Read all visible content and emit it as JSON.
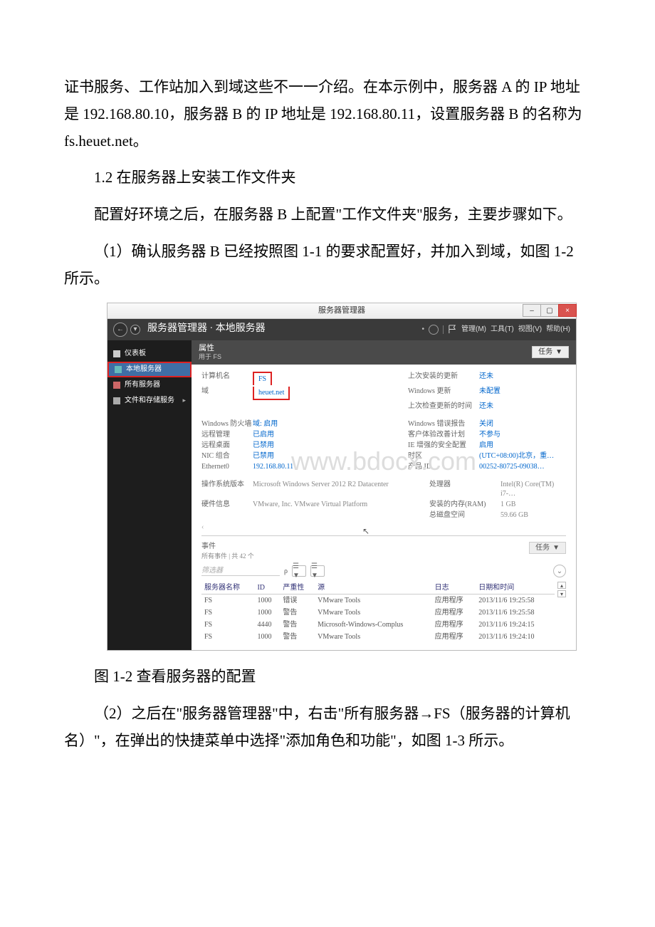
{
  "paragraphs": {
    "p1": "证书服务、工作站加入到域这些不一一介绍。在本示例中，服务器 A 的 IP 地址是 192.168.80.10，服务器 B 的 IP 地址是 192.168.80.11，设置服务器 B 的名称为 fs.heuet.net。",
    "p2": "1.2 在服务器上安装工作文件夹",
    "p3": "配置好环境之后，在服务器 B 上配置\"工作文件夹\"服务，主要步骤如下。",
    "p4": "（1）确认服务器 B 已经按照图 1-1 的要求配置好，并加入到域，如图 1-2 所示。",
    "caption": "图 1-2 查看服务器的配置",
    "p5": "（2）之后在\"服务器管理器\"中，右击\"所有服务器→FS（服务器的计算机名）\"，在弹出的快捷菜单中选择\"添加角色和功能\"，如图 1-3 所示。"
  },
  "window": {
    "title": "服务器管理器",
    "nav_back_aria": "返回",
    "nav_fwd_aria": "前进",
    "breadcrumb": "服务器管理器 · 本地服务器",
    "menu": {
      "refresh": "刷新",
      "manage": "管理(M)",
      "tools": "工具(T)",
      "view": "视图(V)",
      "help": "帮助(H)"
    }
  },
  "sidebar": {
    "dashboard": "仪表板",
    "local": "本地服务器",
    "all": "所有服务器",
    "file": "文件和存储服务"
  },
  "panel": {
    "props_label": "属性",
    "props_sub": "用于 FS",
    "task_label": "任务",
    "task_caret": "▼"
  },
  "properties": {
    "left": {
      "computer_name_lbl": "计算机名",
      "computer_name_val": "FS",
      "domain_lbl": "域",
      "domain_val": "heuet.net",
      "firewall_lbl": "Windows 防火墙",
      "firewall_val": "域: 启用",
      "remote_mgmt_lbl": "远程管理",
      "remote_mgmt_val": "已启用",
      "remote_desktop_lbl": "远程桌面",
      "remote_desktop_val": "已禁用",
      "nic_team_lbl": "NIC 组合",
      "nic_team_val": "已禁用",
      "ethernet_lbl": "Ethernet0",
      "ethernet_val": "192.168.80.11",
      "os_ver_lbl": "操作系统版本",
      "os_ver_val": "Microsoft Windows Server 2012 R2 Datacenter",
      "hw_lbl": "硬件信息",
      "hw_val": "VMware, Inc. VMware Virtual Platform"
    },
    "right": {
      "last_update_lbl": "上次安装的更新",
      "last_update_val": "还未",
      "win_update_lbl": "Windows 更新",
      "win_update_val": "未配置",
      "last_check_lbl": "上次检查更新的时间",
      "last_check_val": "还未",
      "err_report_lbl": "Windows 错误报告",
      "err_report_val": "关闭",
      "ceip_lbl": "客户体验改善计划",
      "ceip_val": "不参与",
      "iesc_lbl": "IE 增强的安全配置",
      "iesc_val": "启用",
      "tz_lbl": "时区",
      "tz_val": "(UTC+08:00)北京，重…",
      "pid_lbl": "产品 ID",
      "pid_val": "00252-80725-09038…",
      "cpu_lbl": "处理器",
      "cpu_val": "Intel(R) Core(TM) i7-…",
      "ram_lbl": "安装的内存(RAM)",
      "ram_val": "1 GB",
      "disk_lbl": "总磁盘空间",
      "disk_val": "59.66 GB"
    }
  },
  "events_panel": {
    "head": "事件",
    "sub": "所有事件 | 共 42 个",
    "filter_placeholder": "筛选器",
    "search_icon": "ρ",
    "filter_btn1": "☰ ▼",
    "filter_btn2": "☰ ▼",
    "expand": "⌄",
    "task_label": "任务",
    "task_caret": "▼",
    "cols": {
      "server": "服务器名称",
      "id": "ID",
      "sev": "严重性",
      "src": "源",
      "log": "日志",
      "dt": "日期和时间"
    },
    "rows": [
      {
        "server": "FS",
        "id": "1000",
        "sev": "错误",
        "src": "VMware Tools",
        "log": "应用程序",
        "dt": "2013/11/6 19:25:58"
      },
      {
        "server": "FS",
        "id": "1000",
        "sev": "警告",
        "src": "VMware Tools",
        "log": "应用程序",
        "dt": "2013/11/6 19:25:58"
      },
      {
        "server": "FS",
        "id": "4440",
        "sev": "警告",
        "src": "Microsoft-Windows-Complus",
        "log": "应用程序",
        "dt": "2013/11/6 19:24:15"
      },
      {
        "server": "FS",
        "id": "1000",
        "sev": "警告",
        "src": "VMware Tools",
        "log": "应用程序",
        "dt": "2013/11/6 19:24:10"
      }
    ]
  },
  "watermark": "www.bdocx.com"
}
